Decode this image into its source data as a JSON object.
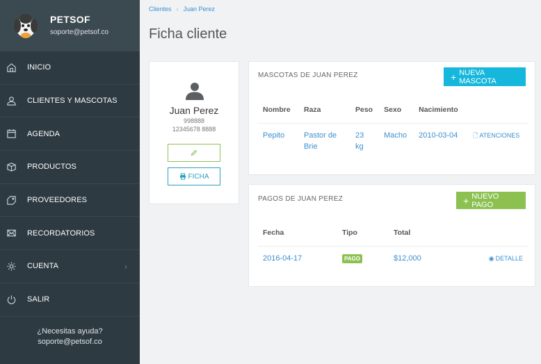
{
  "brand": {
    "name": "PETSOF",
    "email": "soporte@petsof.co"
  },
  "nav": [
    {
      "label": "INICIO",
      "icon": "home-icon"
    },
    {
      "label": "CLIENTES Y MASCOTAS",
      "icon": "user-icon"
    },
    {
      "label": "AGENDA",
      "icon": "calendar-icon"
    },
    {
      "label": "PRODUCTOS",
      "icon": "box-icon"
    },
    {
      "label": "PROVEEDORES",
      "icon": "tag-icon"
    },
    {
      "label": "RECORDATORIOS",
      "icon": "envelope-icon"
    },
    {
      "label": "CUENTA",
      "icon": "gear-icon"
    },
    {
      "label": "SALIR",
      "icon": "power-icon"
    }
  ],
  "help": {
    "line1": "¿Necesitas ayuda?",
    "line2": "soporte@petsof.co"
  },
  "breadcrumb": {
    "root": "Clientes",
    "current": "Juan Perez",
    "sep": "›"
  },
  "page": {
    "title": "Ficha cliente"
  },
  "client": {
    "name": "Juan Perez",
    "phone": "998888",
    "doc": "12345678 8888",
    "ficha_label": "FICHA"
  },
  "mascotas": {
    "title": "MASCOTAS DE JUAN PEREZ",
    "new_label": "NUEVA MASCOTA",
    "headers": [
      "Nombre",
      "Raza",
      "Peso",
      "Sexo",
      "Nacimiento"
    ],
    "rows": [
      {
        "nombre": "Pepito",
        "raza": "Pastor de Brie",
        "peso": "23 kg",
        "sexo": "Macho",
        "nacimiento": "2010-03-04",
        "action": "ATENCIONES"
      }
    ]
  },
  "pagos": {
    "title": "PAGOS DE JUAN PEREZ",
    "new_label": "NUEVO PAGO",
    "headers": [
      "Fecha",
      "Tipo",
      "Total"
    ],
    "rows": [
      {
        "fecha": "2016-04-17",
        "tipo": "PAGO",
        "total": "$12,000",
        "action": "DETALLE"
      }
    ]
  },
  "colors": {
    "sidebar": "#2e3a41",
    "accent_blue": "#16b7dc",
    "accent_green": "#8cc152",
    "link": "#3a8fd0"
  }
}
